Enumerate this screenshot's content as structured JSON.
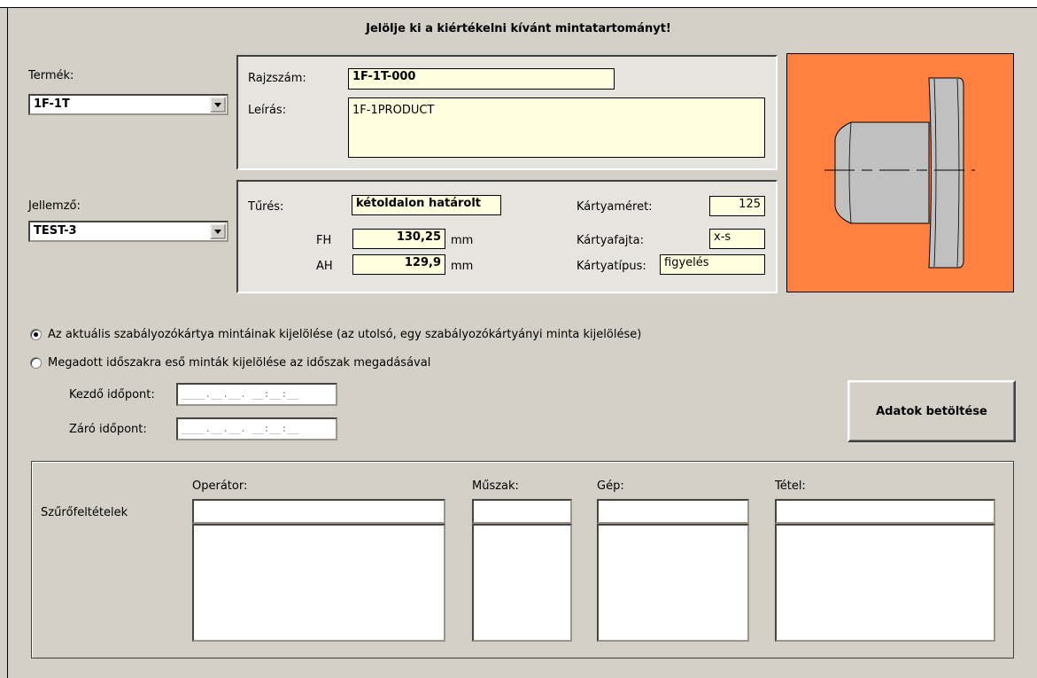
{
  "title": "Jelölje ki a kiértékelni kívánt mintatartományt!",
  "product": {
    "label": "Termék:",
    "value": "1F-1T"
  },
  "feature": {
    "label": "Jellemző:",
    "value": "TEST-3"
  },
  "drawing": {
    "number_label": "Rajzszám:",
    "number_value": "1F-1T-000",
    "desc_label": "Leírás:",
    "desc_value": "1F-1PRODUCT"
  },
  "tolerance": {
    "label": "Tűrés:",
    "value": "kétoldalon határolt",
    "fh_label": "FH",
    "fh_value": "130,25",
    "ah_label": "AH",
    "ah_value": "129,9",
    "unit": "mm"
  },
  "card": {
    "size_label": "Kártyaméret:",
    "size_value": "125",
    "kind_label": "Kártyafajta:",
    "kind_value": "x-s",
    "type_label": "Kártyatípus:",
    "type_value": "figyelés"
  },
  "colors": {
    "preview_background": "#ff8040"
  },
  "selection": {
    "option1_label": "Az aktuális szabályozókártya mintáinak kijelölése (az utolsó, egy szabályozókártyányi minta kijelölése)",
    "option1_checked": true,
    "option2_label": "Megadott időszakra eső minták kijelölése az időszak megadásával",
    "option2_checked": false,
    "start_label": "Kezdő időpont:",
    "start_mask": "____.__.__. __:__:__",
    "end_label": "Záró időpont:",
    "end_mask": "____.__.__. __:__:__"
  },
  "load_button": "Adatok betöltése",
  "filters": {
    "label": "Szűrőfeltételek",
    "operator_label": "Operátor:",
    "shift_label": "Műszak:",
    "machine_label": "Gép:",
    "lot_label": "Tétel:"
  }
}
